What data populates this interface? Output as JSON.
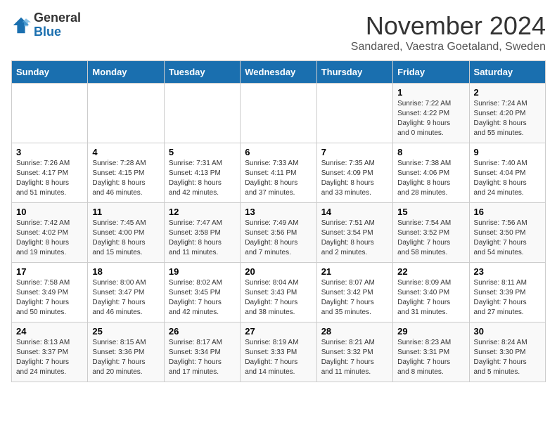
{
  "header": {
    "logo_line1": "General",
    "logo_line2": "Blue",
    "month_title": "November 2024",
    "subtitle": "Sandared, Vaestra Goetaland, Sweden"
  },
  "weekdays": [
    "Sunday",
    "Monday",
    "Tuesday",
    "Wednesday",
    "Thursday",
    "Friday",
    "Saturday"
  ],
  "weeks": [
    [
      {
        "day": "",
        "info": ""
      },
      {
        "day": "",
        "info": ""
      },
      {
        "day": "",
        "info": ""
      },
      {
        "day": "",
        "info": ""
      },
      {
        "day": "",
        "info": ""
      },
      {
        "day": "1",
        "info": "Sunrise: 7:22 AM\nSunset: 4:22 PM\nDaylight: 9 hours\nand 0 minutes."
      },
      {
        "day": "2",
        "info": "Sunrise: 7:24 AM\nSunset: 4:20 PM\nDaylight: 8 hours\nand 55 minutes."
      }
    ],
    [
      {
        "day": "3",
        "info": "Sunrise: 7:26 AM\nSunset: 4:17 PM\nDaylight: 8 hours\nand 51 minutes."
      },
      {
        "day": "4",
        "info": "Sunrise: 7:28 AM\nSunset: 4:15 PM\nDaylight: 8 hours\nand 46 minutes."
      },
      {
        "day": "5",
        "info": "Sunrise: 7:31 AM\nSunset: 4:13 PM\nDaylight: 8 hours\nand 42 minutes."
      },
      {
        "day": "6",
        "info": "Sunrise: 7:33 AM\nSunset: 4:11 PM\nDaylight: 8 hours\nand 37 minutes."
      },
      {
        "day": "7",
        "info": "Sunrise: 7:35 AM\nSunset: 4:09 PM\nDaylight: 8 hours\nand 33 minutes."
      },
      {
        "day": "8",
        "info": "Sunrise: 7:38 AM\nSunset: 4:06 PM\nDaylight: 8 hours\nand 28 minutes."
      },
      {
        "day": "9",
        "info": "Sunrise: 7:40 AM\nSunset: 4:04 PM\nDaylight: 8 hours\nand 24 minutes."
      }
    ],
    [
      {
        "day": "10",
        "info": "Sunrise: 7:42 AM\nSunset: 4:02 PM\nDaylight: 8 hours\nand 19 minutes."
      },
      {
        "day": "11",
        "info": "Sunrise: 7:45 AM\nSunset: 4:00 PM\nDaylight: 8 hours\nand 15 minutes."
      },
      {
        "day": "12",
        "info": "Sunrise: 7:47 AM\nSunset: 3:58 PM\nDaylight: 8 hours\nand 11 minutes."
      },
      {
        "day": "13",
        "info": "Sunrise: 7:49 AM\nSunset: 3:56 PM\nDaylight: 8 hours\nand 7 minutes."
      },
      {
        "day": "14",
        "info": "Sunrise: 7:51 AM\nSunset: 3:54 PM\nDaylight: 8 hours\nand 2 minutes."
      },
      {
        "day": "15",
        "info": "Sunrise: 7:54 AM\nSunset: 3:52 PM\nDaylight: 7 hours\nand 58 minutes."
      },
      {
        "day": "16",
        "info": "Sunrise: 7:56 AM\nSunset: 3:50 PM\nDaylight: 7 hours\nand 54 minutes."
      }
    ],
    [
      {
        "day": "17",
        "info": "Sunrise: 7:58 AM\nSunset: 3:49 PM\nDaylight: 7 hours\nand 50 minutes."
      },
      {
        "day": "18",
        "info": "Sunrise: 8:00 AM\nSunset: 3:47 PM\nDaylight: 7 hours\nand 46 minutes."
      },
      {
        "day": "19",
        "info": "Sunrise: 8:02 AM\nSunset: 3:45 PM\nDaylight: 7 hours\nand 42 minutes."
      },
      {
        "day": "20",
        "info": "Sunrise: 8:04 AM\nSunset: 3:43 PM\nDaylight: 7 hours\nand 38 minutes."
      },
      {
        "day": "21",
        "info": "Sunrise: 8:07 AM\nSunset: 3:42 PM\nDaylight: 7 hours\nand 35 minutes."
      },
      {
        "day": "22",
        "info": "Sunrise: 8:09 AM\nSunset: 3:40 PM\nDaylight: 7 hours\nand 31 minutes."
      },
      {
        "day": "23",
        "info": "Sunrise: 8:11 AM\nSunset: 3:39 PM\nDaylight: 7 hours\nand 27 minutes."
      }
    ],
    [
      {
        "day": "24",
        "info": "Sunrise: 8:13 AM\nSunset: 3:37 PM\nDaylight: 7 hours\nand 24 minutes."
      },
      {
        "day": "25",
        "info": "Sunrise: 8:15 AM\nSunset: 3:36 PM\nDaylight: 7 hours\nand 20 minutes."
      },
      {
        "day": "26",
        "info": "Sunrise: 8:17 AM\nSunset: 3:34 PM\nDaylight: 7 hours\nand 17 minutes."
      },
      {
        "day": "27",
        "info": "Sunrise: 8:19 AM\nSunset: 3:33 PM\nDaylight: 7 hours\nand 14 minutes."
      },
      {
        "day": "28",
        "info": "Sunrise: 8:21 AM\nSunset: 3:32 PM\nDaylight: 7 hours\nand 11 minutes."
      },
      {
        "day": "29",
        "info": "Sunrise: 8:23 AM\nSunset: 3:31 PM\nDaylight: 7 hours\nand 8 minutes."
      },
      {
        "day": "30",
        "info": "Sunrise: 8:24 AM\nSunset: 3:30 PM\nDaylight: 7 hours\nand 5 minutes."
      }
    ]
  ],
  "accent_color": "#1a6faf"
}
